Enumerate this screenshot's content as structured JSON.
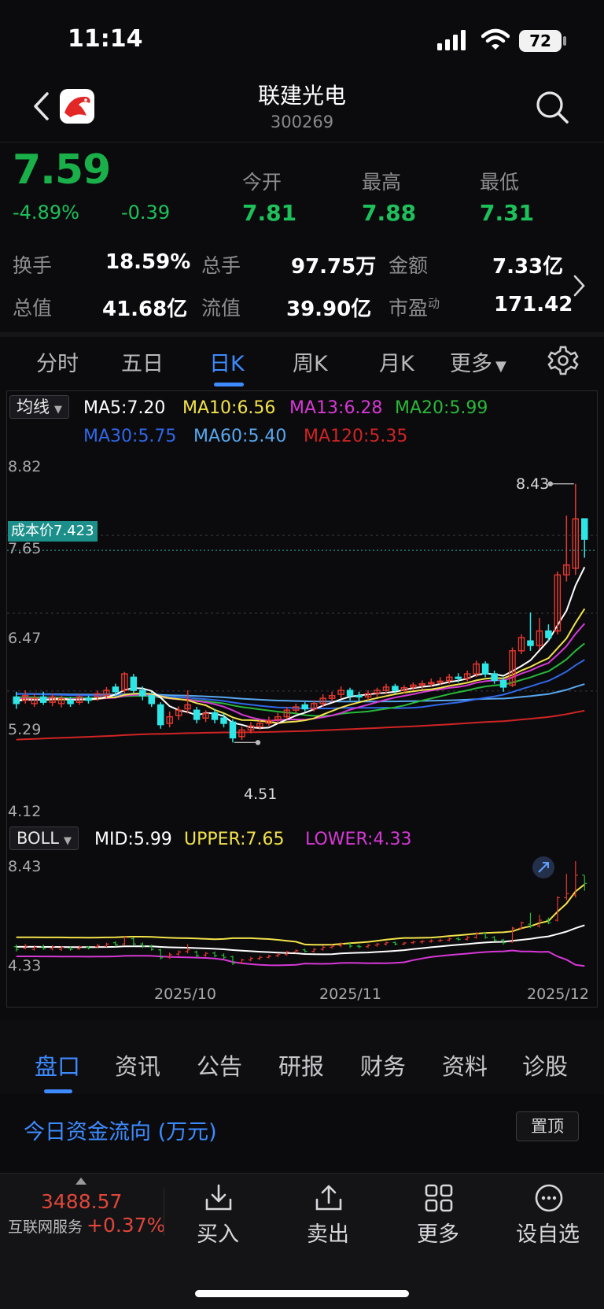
{
  "status_bar": {
    "time": "11:14",
    "battery": "72"
  },
  "header": {
    "title": "联建光电",
    "code": "300269"
  },
  "quote": {
    "price": "7.59",
    "change_pct": "-4.89%",
    "change": "-0.39",
    "open_label": "今开",
    "open": "7.81",
    "high_label": "最高",
    "high": "7.88",
    "low_label": "最低",
    "low": "7.31",
    "turnover_label": "换手",
    "turnover": "18.59%",
    "volume_label": "总手",
    "volume": "97.75万",
    "amount_label": "金额",
    "amount": "7.33亿",
    "mktcap_label": "总值",
    "mktcap": "41.68亿",
    "float_label": "流值",
    "float_cap": "39.90亿",
    "pe_label": "市盈",
    "pe_sup": "动",
    "pe": "171.42"
  },
  "period_tabs": [
    "分时",
    "五日",
    "日K",
    "周K",
    "月K",
    "更多"
  ],
  "active_period": "日K",
  "indicator": {
    "ma_chip": "均线",
    "ma5": "MA5:7.20",
    "ma10": "MA10:6.56",
    "ma13": "MA13:6.28",
    "ma20": "MA20:5.99",
    "ma30": "MA30:5.75",
    "ma60": "MA60:5.40",
    "ma120": "MA120:5.35",
    "boll_chip": "BOLL",
    "mid": "MID:5.99",
    "upper": "UPPER:7.65",
    "lower": "LOWER:4.33",
    "cost_label": "成本价7.423"
  },
  "colors": {
    "up": "#e6382f",
    "down": "#2ee6e6",
    "ma5": "#ffffff",
    "ma10": "#f2e24a",
    "ma13": "#d638d6",
    "ma20": "#28b83a",
    "ma30": "#3068e8",
    "ma60": "#58a8f0",
    "ma120": "#d02424",
    "accent": "#3d8bff"
  },
  "chart_data": {
    "type": "candlestick",
    "y_axis_main": [
      "8.82",
      "7.65",
      "6.47",
      "5.29",
      "4.12"
    ],
    "y_axis_boll": [
      "8.43",
      "4.33"
    ],
    "x_axis": [
      "2025/10",
      "2025/11",
      "2025/12"
    ],
    "annotations": {
      "high_mark": "8.43",
      "low_mark": "4.51"
    },
    "candles": [
      [
        5.2,
        5.1,
        5.28,
        5.02
      ],
      [
        5.15,
        5.22,
        5.3,
        5.1
      ],
      [
        5.1,
        5.18,
        5.25,
        5.05
      ],
      [
        5.2,
        5.12,
        5.28,
        5.08
      ],
      [
        5.12,
        5.2,
        5.25,
        5.06
      ],
      [
        5.1,
        5.18,
        5.22,
        5.04
      ],
      [
        5.15,
        5.1,
        5.2,
        5.05
      ],
      [
        5.12,
        5.2,
        5.24,
        5.08
      ],
      [
        5.18,
        5.15,
        5.22,
        5.1
      ],
      [
        5.2,
        5.25,
        5.3,
        5.14
      ],
      [
        5.22,
        5.3,
        5.35,
        5.18
      ],
      [
        5.35,
        5.28,
        5.4,
        5.2
      ],
      [
        5.3,
        5.55,
        5.58,
        5.26
      ],
      [
        5.5,
        5.3,
        5.55,
        5.25
      ],
      [
        5.3,
        5.22,
        5.36,
        5.15
      ],
      [
        5.22,
        5.1,
        5.28,
        5.05
      ],
      [
        5.08,
        4.78,
        5.12,
        4.72
      ],
      [
        4.8,
        4.9,
        4.98,
        4.74
      ],
      [
        4.92,
        5.0,
        5.06,
        4.85
      ],
      [
        5.02,
        5.08,
        5.3,
        4.95
      ],
      [
        5.0,
        4.86,
        5.05,
        4.8
      ],
      [
        4.88,
        4.95,
        5.0,
        4.82
      ],
      [
        4.96,
        4.86,
        5.02,
        4.8
      ],
      [
        4.88,
        4.8,
        4.95,
        4.74
      ],
      [
        4.82,
        4.58,
        4.86,
        4.51
      ],
      [
        4.6,
        4.7,
        4.75,
        4.55
      ],
      [
        4.7,
        4.76,
        4.82,
        4.65
      ],
      [
        4.75,
        4.8,
        4.85,
        4.7
      ],
      [
        4.8,
        4.84,
        4.9,
        4.76
      ],
      [
        4.86,
        4.9,
        4.96,
        4.8
      ],
      [
        4.9,
        5.0,
        5.05,
        4.86
      ],
      [
        5.0,
        5.05,
        5.1,
        4.95
      ],
      [
        5.08,
        5.02,
        5.12,
        4.98
      ],
      [
        5.02,
        5.1,
        5.15,
        4.98
      ],
      [
        5.1,
        5.18,
        5.24,
        5.05
      ],
      [
        5.18,
        5.22,
        5.28,
        5.12
      ],
      [
        5.24,
        5.3,
        5.36,
        5.18
      ],
      [
        5.3,
        5.22,
        5.34,
        5.15
      ],
      [
        5.22,
        5.2,
        5.28,
        5.14
      ],
      [
        5.2,
        5.25,
        5.3,
        5.15
      ],
      [
        5.26,
        5.3,
        5.34,
        5.2
      ],
      [
        5.3,
        5.35,
        5.4,
        5.24
      ],
      [
        5.36,
        5.3,
        5.4,
        5.25
      ],
      [
        5.3,
        5.34,
        5.38,
        5.26
      ],
      [
        5.35,
        5.38,
        5.42,
        5.3
      ],
      [
        5.38,
        5.4,
        5.45,
        5.32
      ],
      [
        5.4,
        5.42,
        5.48,
        5.35
      ],
      [
        5.42,
        5.44,
        5.5,
        5.38
      ],
      [
        5.45,
        5.5,
        5.55,
        5.4
      ],
      [
        5.5,
        5.48,
        5.56,
        5.42
      ],
      [
        5.48,
        5.55,
        5.6,
        5.44
      ],
      [
        5.55,
        5.7,
        5.75,
        5.5
      ],
      [
        5.7,
        5.55,
        5.74,
        5.5
      ],
      [
        5.55,
        5.45,
        5.6,
        5.4
      ],
      [
        5.45,
        5.35,
        5.5,
        5.28
      ],
      [
        5.38,
        5.9,
        5.95,
        5.35
      ],
      [
        5.9,
        6.1,
        6.15,
        5.85
      ],
      [
        6.05,
        5.98,
        6.48,
        5.9
      ],
      [
        5.98,
        6.2,
        6.4,
        5.92
      ],
      [
        6.2,
        6.1,
        6.3,
        6.05
      ],
      [
        6.2,
        7.05,
        7.1,
        6.15
      ],
      [
        7.05,
        7.2,
        7.95,
        6.95
      ],
      [
        7.15,
        7.9,
        8.43,
        7.05
      ],
      [
        7.9,
        7.59,
        7.88,
        7.31
      ]
    ]
  },
  "bottom_tabs": [
    "盘口",
    "资讯",
    "公告",
    "研报",
    "财务",
    "资料",
    "诊股"
  ],
  "active_bottom_tab": "盘口",
  "fund_flow": {
    "title": "今日资金流向 (万元)",
    "pin": "置顶"
  },
  "bottom_bar": {
    "index_value": "3488.57",
    "index_name": "互联网服务",
    "index_change": "+0.37%",
    "actions": [
      {
        "label": "买入",
        "icon": "download-icon"
      },
      {
        "label": "卖出",
        "icon": "upload-icon"
      },
      {
        "label": "更多",
        "icon": "grid-icon"
      },
      {
        "label": "设自选",
        "icon": "more-circle-icon"
      }
    ]
  }
}
